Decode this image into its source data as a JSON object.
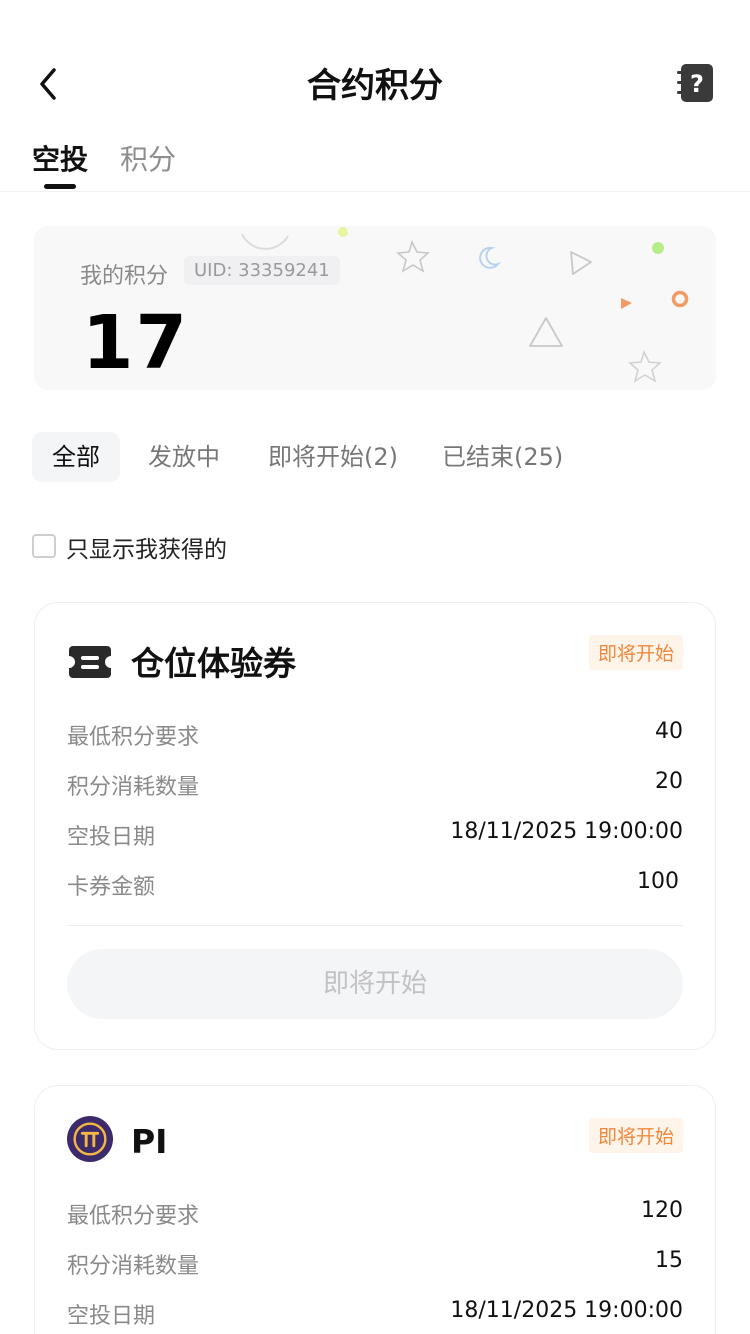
{
  "header": {
    "title": "合约积分",
    "back_icon": "chevron-left-icon",
    "help_icon": "help-book-icon"
  },
  "tabs": [
    {
      "label": "空投",
      "active": true
    },
    {
      "label": "积分",
      "active": false
    }
  ],
  "points": {
    "label": "我的积分",
    "uid": "UID: 33359241",
    "value": "17"
  },
  "filters": [
    {
      "label": "全部",
      "active": true
    },
    {
      "label": "发放中",
      "active": false
    },
    {
      "label": "即将开始(2)",
      "active": false
    },
    {
      "label": "已结束(25)",
      "active": false
    }
  ],
  "only_mine": {
    "label": "只显示我获得的",
    "checked": false
  },
  "cards": [
    {
      "title": "仓位体验券",
      "icon": "ticket-icon",
      "status": "即将开始",
      "rows": [
        {
          "label": "最低积分要求",
          "value": "40"
        },
        {
          "label": "积分消耗数量",
          "value": "20"
        },
        {
          "label": "空投日期",
          "value": "18/11/2025 19:00:00"
        },
        {
          "label": "卡券金额",
          "value": "100"
        }
      ],
      "button": "即将开始"
    },
    {
      "title": "PI",
      "icon": "pi-coin-icon",
      "status": "即将开始",
      "rows": [
        {
          "label": "最低积分要求",
          "value": "120"
        },
        {
          "label": "积分消耗数量",
          "value": "15"
        },
        {
          "label": "空投日期",
          "value": "18/11/2025 19:00:00"
        }
      ]
    }
  ],
  "colors": {
    "accent_orange": "#f0883c",
    "badge_bg": "#fff4ea",
    "pi_purple": "#3d2a6b",
    "pi_gold": "#f3b743"
  }
}
